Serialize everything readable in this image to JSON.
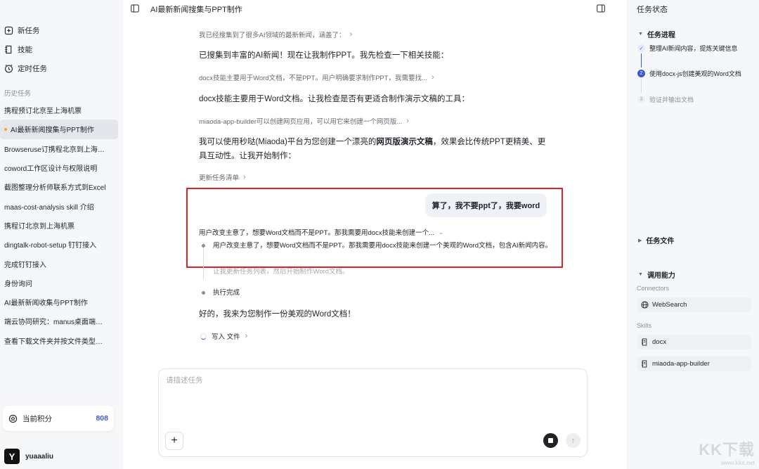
{
  "sidebar": {
    "nav": [
      {
        "label": "新任务",
        "icon": "new-task-icon"
      },
      {
        "label": "技能",
        "icon": "skills-icon"
      },
      {
        "label": "定时任务",
        "icon": "clock-icon"
      }
    ],
    "history_label": "历史任务",
    "history": [
      "携程预订北京至上海机票",
      "AI最新新闻搜集与PPT制作",
      "Browseruse订携程北京到上海机票",
      "coword工作区设计与权限说明",
      "截图整理分析师联系方式到Excel",
      "maas-cost-analysis skill 介绍",
      "携程订北京到上海机票",
      "dingtalk-robot-setup 钉钉接入",
      "完成钉钉接入",
      "身份询问",
      "AI最新新闻收集与PPT制作",
      "端云协同研究：manus桌面端与云端能力",
      "查看下载文件夹并按文件类型整理"
    ],
    "active_index": 1,
    "points_label": "当前积分",
    "points_value": "808",
    "user_initial": "Y",
    "username": "yuaaaliu"
  },
  "main": {
    "title": "AI最新新闻搜集与PPT制作",
    "step1": "我已经搜集到了很多AI领域的最新新闻，涵盖了：",
    "para1": "已搜集到丰富的AI新闻！现在让我制作PPT。我先检查一下相关技能：",
    "step2": "docx技能主要用于Word文档，不是PPT。用户明确要求制作PPT，我需要找...",
    "para2": "docx技能主要用于Word文档。让我检查是否有更适合制作演示文稿的工具：",
    "step3": "miaoda-app-builder可以创建网页应用，可以用它来创建一个网页版...",
    "para3a": "我可以使用秒哒(Miaoda)平台为您创建一个漂亮的",
    "para3b": "网页版演示文稿",
    "para3c": "，效果会比传统PPT更精美、更具互动性。让我开始制作：",
    "step4": "更新任务清单",
    "user_msg": "算了，我不要ppt了，我要word",
    "thinking": "用户改变主意了，想要Word文档而不是PPT。那我需要用docx技能来创建一个...",
    "tl1": "用户改变主意了，想要Word文档而不是PPT。那我需要用docx技能来创建一个美观的Word文档，包含AI新闻内容。",
    "tl2": "让我更新任务列表，然后开始制作Word文档。",
    "tl3": "执行完成",
    "para4": "好的，我来为您制作一份美观的Word文档！",
    "write": "写入 文件",
    "composer_placeholder": "请描述任务"
  },
  "right": {
    "title": "任务状态",
    "progress_label": "任务进程",
    "steps": [
      {
        "label": "整理AI新闻内容，提炼关键信息",
        "state": "done",
        "num": "✓"
      },
      {
        "label": "使用docx-js创建美观的Word文档",
        "state": "active",
        "num": "2"
      },
      {
        "label": "验证并输出文档",
        "state": "todo",
        "num": "3"
      }
    ],
    "files_label": "任务文件",
    "ability_label": "调用能力",
    "connectors_label": "Connectors",
    "connectors": [
      "WebSearch"
    ],
    "skills_label": "Skills",
    "skills": [
      "docx",
      "miaoda-app-builder"
    ]
  },
  "watermark": {
    "text": "KK下载",
    "url": "www.kkx.net"
  }
}
